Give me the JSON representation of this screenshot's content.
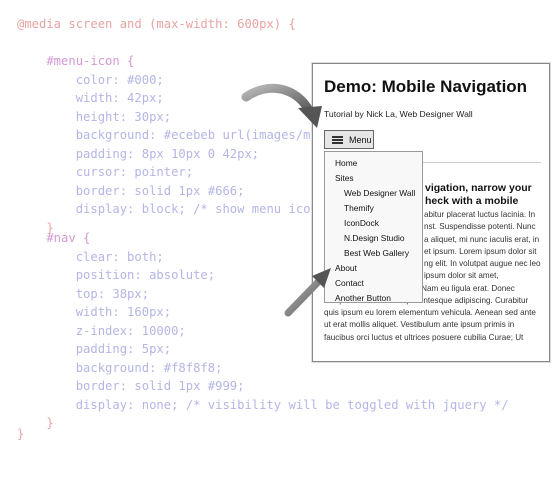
{
  "code": {
    "lines": [
      "@media screen and (max-width: 600px) {",
      "",
      "    #menu-icon {",
      "        color: #000;",
      "        width: 42px;",
      "        height: 30px;",
      "        background: #ecebeb url(images/menu",
      "        padding: 8px 10px 0 42px;",
      "        cursor: pointer;",
      "        border: solid 1px #666;",
      "        display: block; /* show menu icon",
      "    }",
      "",
      "    #nav {",
      "        clear: both;",
      "        position: absolute;",
      "        top: 38px;",
      "        width: 160px;",
      "        z-index: 10000;",
      "        padding: 5px;",
      "        background: #f8f8f8;",
      "        border: solid 1px #999;",
      "        display: none; /* visibility will be toggled with jquery */",
      "    }",
      "",
      "}"
    ]
  },
  "preview": {
    "title": "Demo: Mobile Navigation",
    "subtitle": "Tutorial by Nick La, Web Designer Wall",
    "menu_label": "Menu",
    "article_heading": "vigation, narrow your\nheck with a mobile",
    "body_lines": [
      "abitur placerat luctus lacinia. In",
      "nst. Suspendisse potenti. Nunc",
      "a aliquet, mi nunc iaculis erat, in",
      "et ipsum. Lorem ipsum dolor sit",
      "ng elit. In volutpat augue nec leo",
      "ipsum dolor sit amet,",
      "consectetur adipiscing elit. Nam eu ligula erat. Donec",
      "semper mauris et nibh pellentesque adipiscing. Curabitur",
      "quis ipsum eu lorem elementum vehicula. Aenean sed ante",
      "ut erat mollis aliquet. Vestibulum ante ipsum primis in",
      "faucibus orci luctus et ultrices posuere cubilia Curae; Ut"
    ],
    "nav_items": [
      {
        "label": "Home",
        "indent": false
      },
      {
        "label": "Sites",
        "indent": false
      },
      {
        "label": "Web Designer Wall",
        "indent": true
      },
      {
        "label": "Themify",
        "indent": true
      },
      {
        "label": "IconDock",
        "indent": true
      },
      {
        "label": "N.Design Studio",
        "indent": true
      },
      {
        "label": "Best Web Gallery",
        "indent": true
      },
      {
        "label": "About",
        "indent": false
      },
      {
        "label": "Contact",
        "indent": false
      },
      {
        "label": "Another Button",
        "indent": false
      }
    ]
  },
  "icons": {
    "menu_icon": "hamburger-icon",
    "arrows": [
      "curved-arrow-icon",
      "diagonal-arrow-icon"
    ]
  }
}
